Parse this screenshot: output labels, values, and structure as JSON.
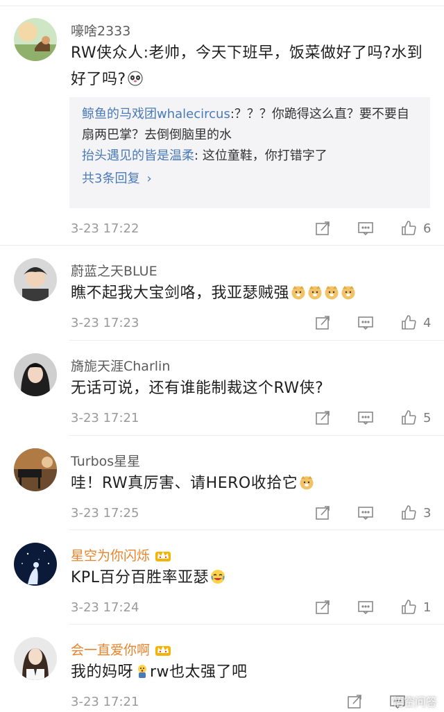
{
  "comments": [
    {
      "username": "嚎啥2333",
      "text": "RW侠众人:老帅，今天下班早，饭菜做好了吗?水到好了吗?",
      "emoji": "panda-face",
      "replies": [
        {
          "user": "鲸鱼的马戏团whalecircus",
          "text": ":？？？你跪得这么直？要不要自扇两巴掌？去倒倒脑里的水"
        },
        {
          "user": "抬头遇见的皆是温柔",
          "text": ": 这位童鞋，你打错字了"
        }
      ],
      "more_replies": "共3条回复",
      "time": "3-23 17:22",
      "likes": "6"
    },
    {
      "username": "蔚蓝之天BLUE",
      "text": "瞧不起我大宝剑咯，我亚瑟贼强",
      "emoji": "doge-x4",
      "time": "3-23 17:23",
      "likes": "4"
    },
    {
      "username": "旖旎天涯Charlin",
      "text": "无话可说，还有谁能制裁这个RW侠?",
      "time": "3-23 17:21",
      "likes": "5"
    },
    {
      "username": "Turbos星星",
      "text": "哇！RW真厉害、请HERO收拾它",
      "emoji": "doge",
      "time": "3-23 17:25",
      "likes": "3"
    },
    {
      "username": "星空为你闪烁",
      "text": "KPL百分百胜率亚瑟",
      "emoji": "laugh-cry",
      "time": "3-23 17:24",
      "likes": "1",
      "vip": true
    },
    {
      "username": "会一直爱你啊",
      "text_before": "我的妈呀",
      "text_after": "rw也太强了吧",
      "emoji": "shocked",
      "time": "3-23 17:21",
      "vip": true
    }
  ],
  "watermark": "悟空问答",
  "colors": {
    "link": "#4a7ab7",
    "vip_name": "#e8842b",
    "muted": "#9a9a9a"
  }
}
